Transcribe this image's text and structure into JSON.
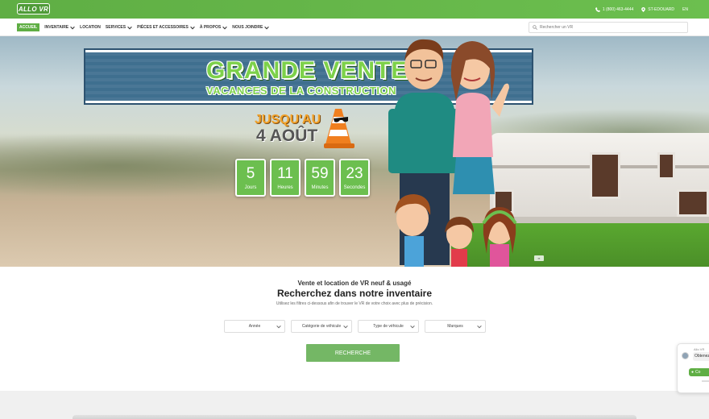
{
  "header": {
    "logo_text": "ALLO VR",
    "phone": "1 (800) 463-4444",
    "location": "ST-EDOUARD",
    "language": "EN",
    "colors": {
      "brand_green": "#6cbf4f",
      "button_green": "#74b765"
    }
  },
  "nav": {
    "items": [
      {
        "label": "ACCUEIL",
        "active": true,
        "has_dropdown": false
      },
      {
        "label": "INVENTAIRE",
        "active": false,
        "has_dropdown": true
      },
      {
        "label": "LOCATION",
        "active": false,
        "has_dropdown": false
      },
      {
        "label": "SERVICES",
        "active": false,
        "has_dropdown": true
      },
      {
        "label": "PIÈCES ET ACCESSOIRES",
        "active": false,
        "has_dropdown": true
      },
      {
        "label": "À PROPOS",
        "active": false,
        "has_dropdown": true
      },
      {
        "label": "NOUS JOINDRE",
        "active": false,
        "has_dropdown": true
      }
    ],
    "search_placeholder": "Rechercher un VR"
  },
  "hero": {
    "title": "GRANDE VENTE",
    "subtitle": "VACANCES DE LA CONSTRUCTION",
    "until_label": "JUSQU'AU",
    "until_date": "4 AOÛT",
    "countdown": [
      {
        "value": "5",
        "label": "Jours"
      },
      {
        "value": "11",
        "label": "Heures"
      },
      {
        "value": "59",
        "label": "Minutes"
      },
      {
        "value": "23",
        "label": "Secondes"
      }
    ]
  },
  "search_section": {
    "subtitle": "Vente et location de VR neuf & usagé",
    "title": "Recherchez dans notre inventaire",
    "description": "Utilisez les filtres ci-dessous afin de trouver le VR de votre choix avec plus de précision.",
    "filters": [
      {
        "label": "Année"
      },
      {
        "label": "Catégorie de véhicule"
      },
      {
        "label": "Type de véhicule"
      },
      {
        "label": "Marques"
      }
    ],
    "button_label": "RECHERCHE"
  },
  "chat": {
    "agent_name": "Allo VR",
    "message": "Obtenez",
    "button_label": "Co"
  }
}
